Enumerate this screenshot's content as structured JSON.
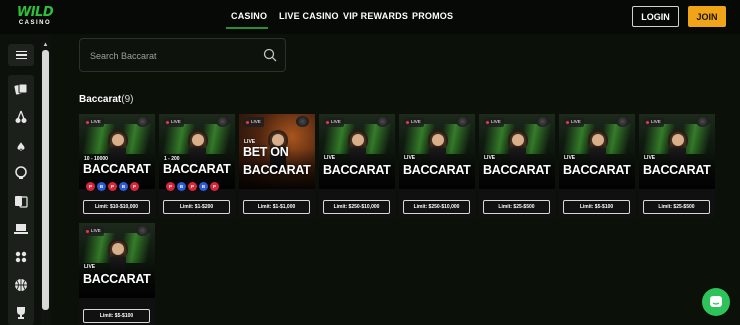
{
  "header": {
    "logo_top": "WILD",
    "logo_bottom": "CASINO",
    "nav": [
      "CASINO",
      "LIVE CASINO",
      "VIP REWARDS",
      "PROMOS"
    ],
    "active_nav": "CASINO",
    "login_label": "LOGIN",
    "join_label": "JOIN",
    "accent_color": "#2a8f34",
    "join_color": "#f0a418"
  },
  "sidebar": {
    "icons": [
      "menu-icon",
      "cards-icon",
      "cherries-icon",
      "spade-icon",
      "trophy-cup-icon",
      "flip-cards-icon",
      "laptop-icon",
      "grid-icon",
      "basketball-icon",
      "trophy-icon"
    ]
  },
  "search": {
    "placeholder": "Search Baccarat"
  },
  "section": {
    "title": "Baccarat",
    "count": "(9)"
  },
  "games": [
    {
      "badge": "LIVE",
      "sub": "10 - 10000",
      "title": "BACCARAT",
      "limit": "Limit: $10-$10,000",
      "roadmap": [
        "P",
        "B",
        "P",
        "B",
        "P"
      ],
      "theme": "green"
    },
    {
      "badge": "LIVE",
      "sub": "1 - 200",
      "title": "BACCARAT",
      "limit": "Limit: $1-$200",
      "roadmap": [
        "P",
        "B",
        "P",
        "B",
        "P"
      ],
      "theme": "green"
    },
    {
      "badge": "LIVE",
      "sub": "LIVE",
      "title": "BET ON BACCARAT",
      "title_line1": "BET ON",
      "title_line2": "BACCARAT",
      "limit": "Limit: $1-$1,000",
      "theme": "orange"
    },
    {
      "badge": "LIVE",
      "sub": "LIVE",
      "title": "BACCARAT",
      "limit": "Limit: $250-$10,000",
      "theme": "green"
    },
    {
      "badge": "LIVE",
      "sub": "LIVE",
      "title": "BACCARAT",
      "limit": "Limit: $250-$10,000",
      "theme": "green"
    },
    {
      "badge": "LIVE",
      "sub": "LIVE",
      "title": "BACCARAT",
      "limit": "Limit: $25-$500",
      "theme": "green"
    },
    {
      "badge": "LIVE",
      "sub": "LIVE",
      "title": "BACCARAT",
      "limit": "Limit: $5-$100",
      "theme": "green"
    },
    {
      "badge": "LIVE",
      "sub": "LIVE",
      "title": "BACCARAT",
      "limit": "Limit: $25-$500",
      "theme": "green"
    },
    {
      "badge": "LIVE",
      "sub": "LIVE",
      "title": "BACCARAT",
      "limit": "Limit: $5-$100",
      "theme": "green"
    }
  ],
  "chat": {
    "icon": "chat-icon",
    "color": "#2ec25b"
  }
}
